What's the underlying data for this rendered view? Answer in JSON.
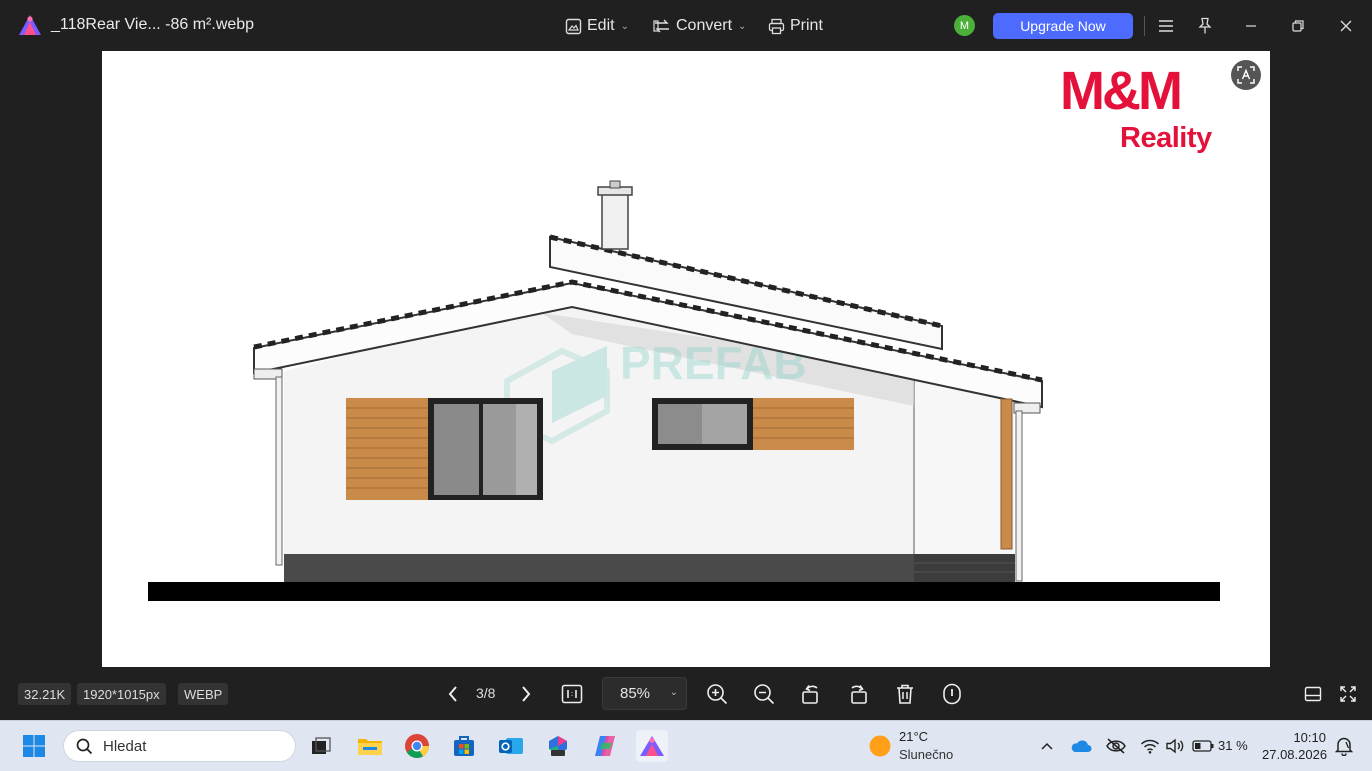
{
  "titlebar": {
    "file_name": "_118Rear Vie... -86 m².webp",
    "edit_label": "Edit",
    "convert_label": "Convert",
    "print_label": "Print",
    "avatar_initial": "M",
    "upgrade_label": "Upgrade Now"
  },
  "image": {
    "brand_line1": "M&M",
    "brand_line2": "Reality",
    "watermark": "PREFAB"
  },
  "bottombar": {
    "file_size": "32.21K",
    "dimensions": "1920*1015px",
    "format": "WEBP",
    "page_indicator": "3/8",
    "zoom": "85%"
  },
  "taskbar": {
    "search_placeholder": "Hledat",
    "weather_temp": "21°C",
    "weather_desc": "Slunečno",
    "battery": "31 %",
    "time": "10:10",
    "date": "27.08.2026"
  },
  "colors": {
    "accent": "#4d6bfe",
    "brand_red": "#e4123b",
    "avatar": "#4caf3a"
  }
}
